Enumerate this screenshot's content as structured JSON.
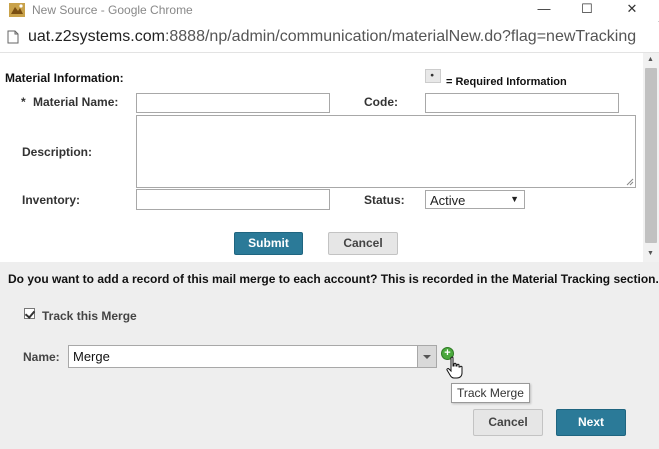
{
  "window": {
    "title": "New Source - Google Chrome",
    "minimize": "—",
    "maximize": "☐",
    "close": "✕"
  },
  "address": {
    "host": "uat.z2systems.com",
    "path": ":8888/np/admin/communication/materialNew.do?flag=newTracking"
  },
  "form": {
    "section_title": "Material Information:",
    "required_legend": "= Required Information",
    "required_marker": "*",
    "material_name_label": "Material Name:",
    "code_label": "Code:",
    "description_label": "Description:",
    "inventory_label": "Inventory:",
    "status_label": "Status:",
    "status_value": "Active",
    "submit_label": "Submit",
    "cancel_label": "Cancel"
  },
  "page": {
    "question": "Do you want to add a record of this mail merge to each account? This is recorded in the Material Tracking section.",
    "track_label": "Track this Merge",
    "track_checked": true,
    "name_label": "Name:",
    "name_value": "Merge",
    "tooltip": "Track Merge",
    "cancel_label": "Cancel",
    "next_label": "Next"
  },
  "colors": {
    "primary_button": "#2b7a98",
    "add_icon": "#4aa83c"
  }
}
